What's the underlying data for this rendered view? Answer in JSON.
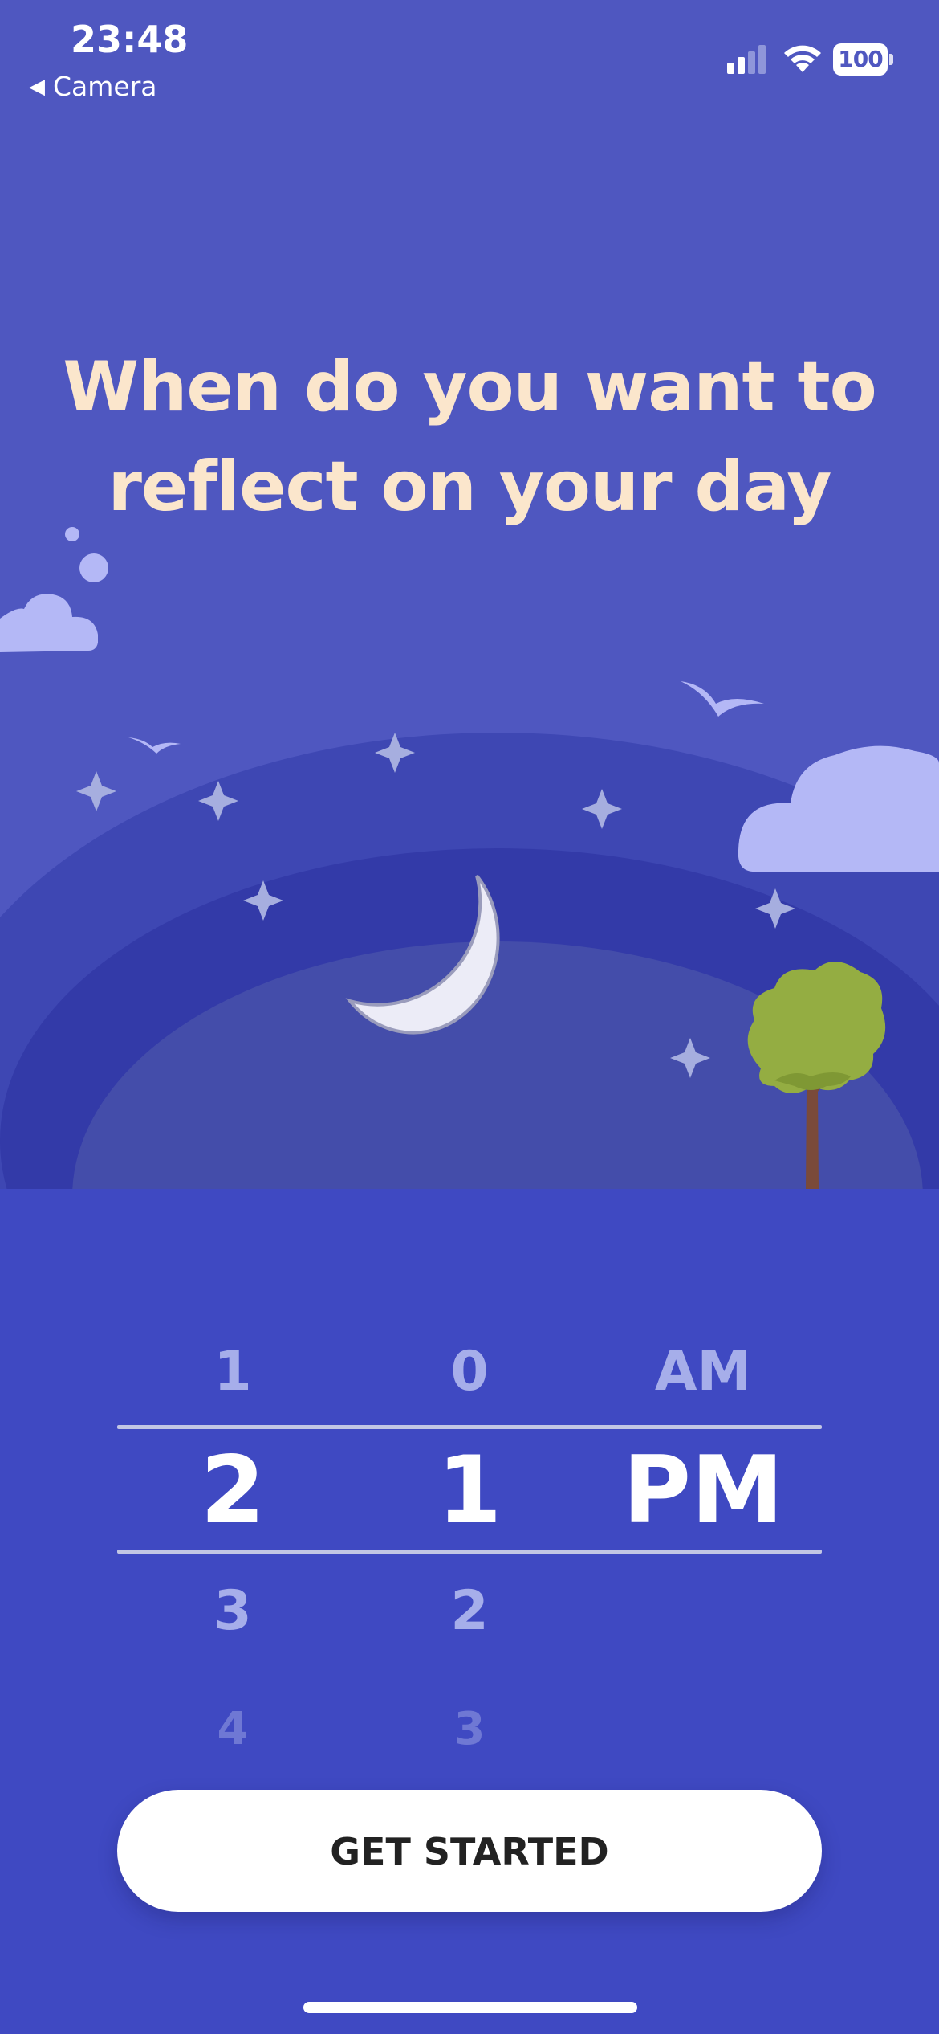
{
  "status_bar": {
    "time": "23:48",
    "back_label": "Camera",
    "battery": "100"
  },
  "onboarding": {
    "headline_line1": "When do you want to",
    "headline_line2": "reflect on your day"
  },
  "time_picker": {
    "hour": {
      "above": "1",
      "selected": "2",
      "below": "3",
      "below2": "4"
    },
    "minute": {
      "above": "0",
      "selected": "1",
      "below": "2",
      "below2": "3"
    },
    "period": {
      "above": "AM",
      "selected": "PM"
    }
  },
  "cta": {
    "label": "GET STARTED"
  },
  "colors": {
    "background": "#4f57c0",
    "picker_background": "#3f49c2",
    "headline": "#fbe6cc",
    "cloud": "#b4b8f6",
    "tree": "#94ad42"
  }
}
